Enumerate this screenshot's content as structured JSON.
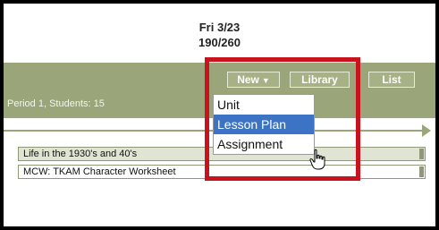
{
  "header": {
    "date": "Fri 3/23",
    "day_count": "190/260"
  },
  "toolbar": {
    "new_label": "New",
    "library_label": "Library",
    "list_label": "List"
  },
  "period": {
    "label": "Period 1, Students: 15"
  },
  "new_menu": {
    "items": [
      "Unit",
      "Lesson Plan",
      "Assignment"
    ],
    "selected": "Lesson Plan"
  },
  "lessons": [
    "Life in the 1930's and 40's",
    "MCW: TKAM Character Worksheet"
  ],
  "colors": {
    "band": "#9aa67a",
    "highlight_border": "#c8131e",
    "menu_selected": "#3d73c4"
  }
}
